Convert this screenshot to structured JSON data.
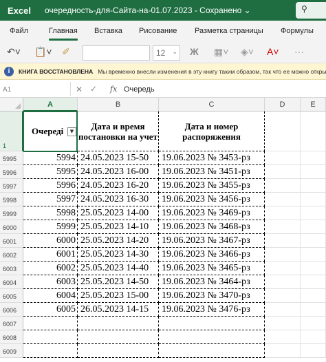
{
  "title_bar": {
    "app_name": "Excel",
    "document": "очередность-для-Сайта-на-01.07.2023  -  Сохранено ⌄"
  },
  "ribbon": {
    "tabs": [
      "Файл",
      "Главная",
      "Вставка",
      "Рисование",
      "Разметка страницы",
      "Формулы"
    ],
    "active_tab": "Главная",
    "font_size": "12",
    "bold_label": "Ж"
  },
  "info_bar": {
    "title": "КНИГА ВОССТАНОВЛЕНА",
    "message": "Мы временно внесли изменения в эту книгу таким образом, так что ее можно открыть"
  },
  "formula_bar": {
    "name_box": "A1",
    "fx": "fx",
    "value": "Очередь"
  },
  "grid": {
    "columns": [
      "A",
      "B",
      "C",
      "D",
      "E"
    ],
    "selected_column": "A",
    "header_row_number": "1",
    "headers": {
      "a": "Очереді",
      "b": "Дата и время постановки на учет",
      "c": "Дата и номер распоряжения"
    },
    "rows": [
      {
        "num": "5995",
        "a": "5994",
        "b": "24.05.2023 15-50",
        "c": "19.06.2023 № 3453-рз"
      },
      {
        "num": "5996",
        "a": "5995",
        "b": "24.05.2023 16-00",
        "c": "19.06.2023 № 3451-рз"
      },
      {
        "num": "5997",
        "a": "5996",
        "b": "24.05.2023 16-20",
        "c": "19.06.2023 № 3455-рз"
      },
      {
        "num": "5998",
        "a": "5997",
        "b": "24.05.2023 16-30",
        "c": "19.06.2023 № 3456-рз"
      },
      {
        "num": "5999",
        "a": "5998",
        "b": "25.05.2023 14-00",
        "c": "19.06.2023 № 3469-рз"
      },
      {
        "num": "6000",
        "a": "5999",
        "b": "25.05.2023 14-10",
        "c": "19.06.2023 № 3468-рз"
      },
      {
        "num": "6001",
        "a": "6000",
        "b": "25.05.2023 14-20",
        "c": "19.06.2023 № 3467-рз"
      },
      {
        "num": "6002",
        "a": "6001",
        "b": "25.05.2023 14-30",
        "c": "19.06.2023 № 3466-рз"
      },
      {
        "num": "6003",
        "a": "6002",
        "b": "25.05.2023 14-40",
        "c": "19.06.2023 № 3465-рз"
      },
      {
        "num": "6004",
        "a": "6003",
        "b": "25.05.2023 14-50",
        "c": "19.06.2023 № 3464-рз"
      },
      {
        "num": "6005",
        "a": "6004",
        "b": "25.05.2023 15-00",
        "c": "19.06.2023 № 3470-рз"
      },
      {
        "num": "6006",
        "a": "6005",
        "b": "26.05.2023 14-15",
        "c": "19.06.2023 № 3476-рз"
      },
      {
        "num": "6007",
        "a": "",
        "b": "",
        "c": ""
      },
      {
        "num": "6008",
        "a": "",
        "b": "",
        "c": ""
      },
      {
        "num": "6009",
        "a": "",
        "b": "",
        "c": ""
      }
    ]
  },
  "colors": {
    "excel_green": "#1e6e42",
    "info_bar_bg": "#fef5d3"
  }
}
